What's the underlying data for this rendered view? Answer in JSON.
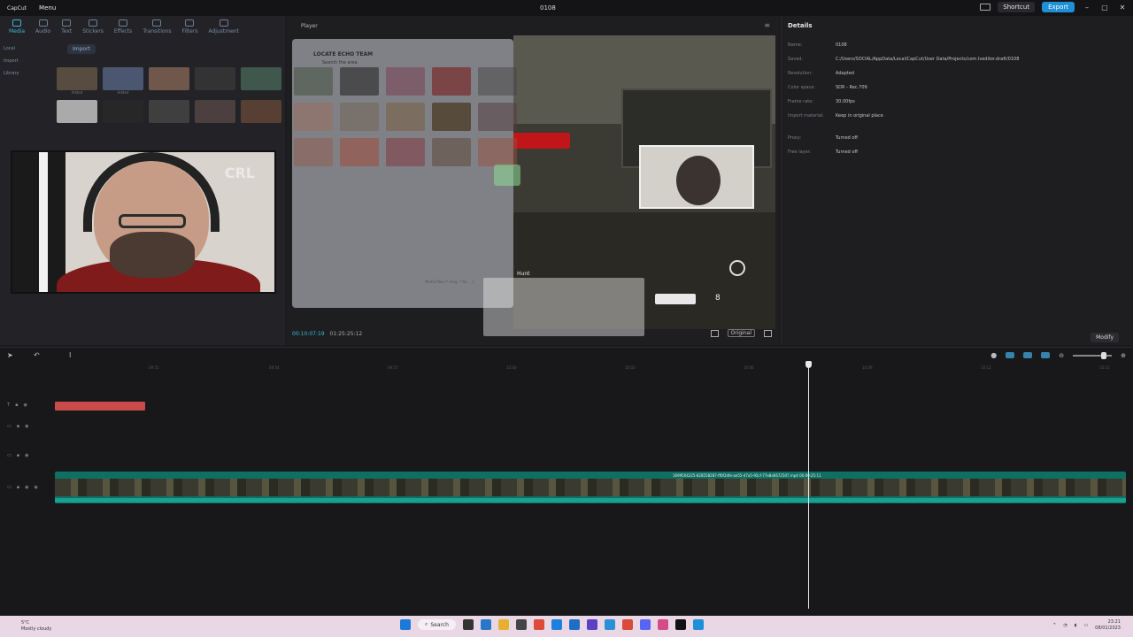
{
  "titlebar": {
    "logo": "CapCut",
    "menu": "Menu",
    "project_name": "0108",
    "shortcut": "Shortcut",
    "export": "Export",
    "controls": [
      "–",
      "▢",
      "✕"
    ]
  },
  "media": {
    "tabs": [
      "Media",
      "Audio",
      "Text",
      "Stickers",
      "Effects",
      "Transitions",
      "Filters",
      "Adjustment"
    ],
    "sidebar": [
      "Local",
      "Import",
      "Library"
    ],
    "import_label": "Import",
    "added_labels": [
      "Added",
      "Added"
    ]
  },
  "player": {
    "title": "Player",
    "hud_hunt": "Hunt",
    "ammo": "8",
    "current_time": "00:10:07:19",
    "total_time": "01:25:25:12",
    "ratio_label": "Original"
  },
  "dialog": {
    "title": "LOCATE ECHO TEAM",
    "subtitle": "Search the area",
    "footer": "Media files (*.mng, *.flv, ...)"
  },
  "details": {
    "title": "Details",
    "rows": [
      {
        "key": "Name:",
        "value": "0108"
      },
      {
        "key": "Saved:",
        "value": "C:/Users/SOCIAL/AppData/Local/CapCut/User Data/Projects/com.lveditor.draft/0108"
      },
      {
        "key": "Resolution:",
        "value": "Adapted"
      },
      {
        "key": "Color space:",
        "value": "SDR - Rec.709"
      },
      {
        "key": "Frame rate:",
        "value": "30.00fps"
      },
      {
        "key": "Import material:",
        "value": "Keep in original place"
      }
    ],
    "rows2": [
      {
        "key": "Proxy:",
        "value": "Turned off"
      },
      {
        "key": "Free layer:",
        "value": "Turned off"
      }
    ],
    "modify": "Modify"
  },
  "timeline": {
    "ruler_ticks": [
      "09:51",
      "09:54",
      "09:57",
      "10:00",
      "10:03",
      "10:06",
      "10:09",
      "10:12",
      "10:15"
    ],
    "clip_label": "1699504225-828558287-ff0f2dfe-ae55-47a5-95cf-77e8a6672507.mp4   00:00:25:11"
  },
  "taskbar": {
    "weather_temp": "5°C",
    "weather_text": "Mostly cloudy",
    "search": "Search",
    "time": "23:21",
    "date": "08/01/2023"
  },
  "colors": {
    "accent": "#1f8fd6",
    "track": "#0f6f63",
    "text_clip": "#c84a4a"
  }
}
